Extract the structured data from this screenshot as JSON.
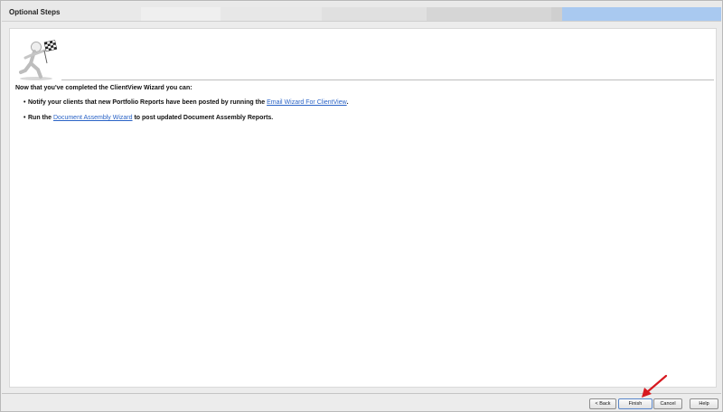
{
  "header": {
    "title": "Optional Steps"
  },
  "content": {
    "intro": "Now that you've completed the ClientView Wizard you can:",
    "steps": [
      {
        "before": "Notify your clients that new Portfolio Reports have been posted by running the ",
        "link": "Email Wizard For ClientView",
        "after": "."
      },
      {
        "before": "Run the ",
        "link": "Document Assembly Wizard",
        "after": " to post updated Document Assembly Reports."
      }
    ]
  },
  "footer": {
    "buttons": {
      "back": "< Back",
      "finish": "Finish",
      "cancel": "Cancel",
      "help": "Help"
    }
  },
  "colors": {
    "link": "#2a63c6",
    "header_accent": "#a9c9f0",
    "annotation_arrow": "#d71920"
  },
  "icons": {
    "wizard_figure": "running-figure-with-checkered-flag",
    "annotation": "red-arrow-pointing-to-finish"
  }
}
